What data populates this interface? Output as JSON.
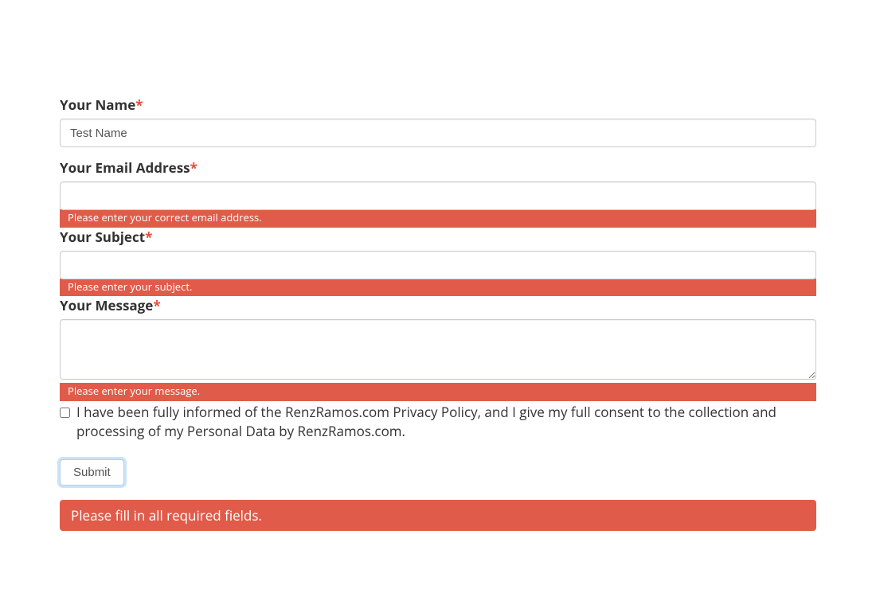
{
  "form": {
    "name": {
      "label": "Your Name",
      "required_marker": "*",
      "value": "Test Name"
    },
    "email": {
      "label": "Your Email Address",
      "required_marker": "*",
      "value": "",
      "error": "Please enter your correct email address."
    },
    "subject": {
      "label": "Your Subject",
      "required_marker": "*",
      "value": "",
      "error": "Please enter your subject."
    },
    "message": {
      "label": "Your Message",
      "required_marker": "*",
      "value": "",
      "error": "Please enter your message."
    },
    "consent": {
      "checked": false,
      "text": "I have been fully informed of the RenzRamos.com Privacy Policy, and I give my full consent to the collection and processing of my Personal Data by RenzRamos.com."
    },
    "submit_label": "Submit",
    "global_error": "Please fill in all required fields."
  }
}
